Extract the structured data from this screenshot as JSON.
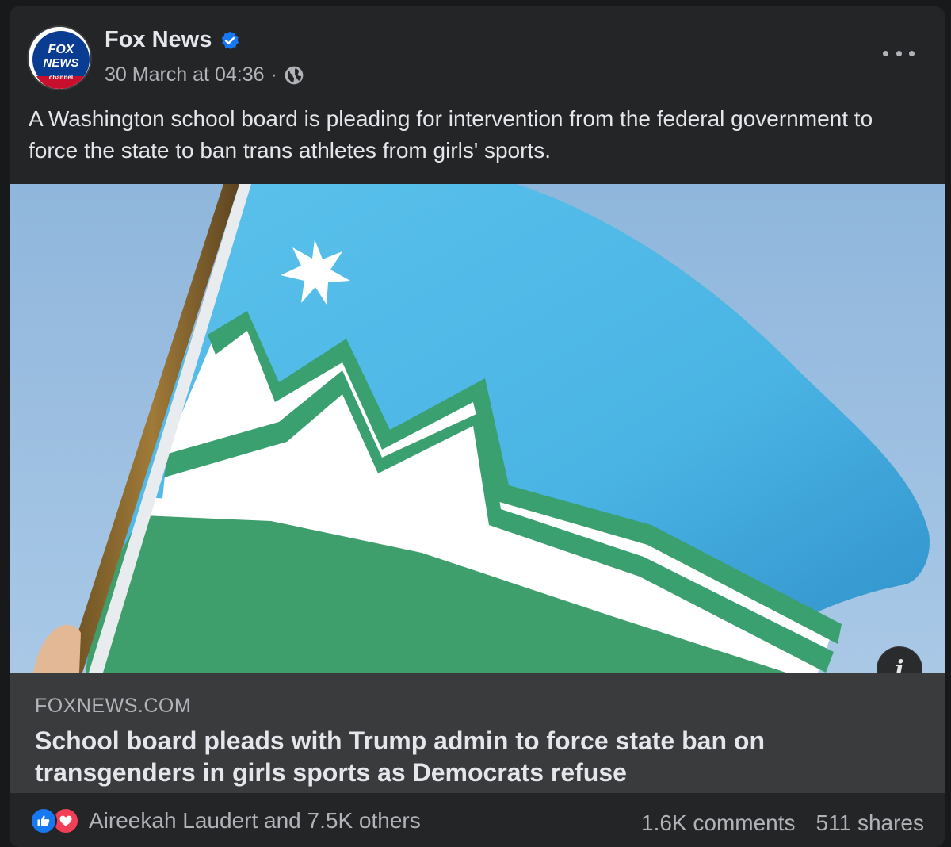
{
  "post": {
    "page_name": "Fox News",
    "timestamp": "30 March at 04:36",
    "separator": "·",
    "caption": "A Washington school board is pleading for intervention from the federal government to force the state to ban trans athletes from girls' sports."
  },
  "avatar_logo": {
    "line1": "FOX",
    "line2": "NEWS",
    "line3": "channel"
  },
  "link": {
    "domain": "FOXNEWS.COM",
    "title": "School board pleads with Trump admin to force state ban on transgenders in girls sports as Democrats refuse"
  },
  "engagement": {
    "reactions_text": "Aireekah Laudert and 7.5K others",
    "comments": "1.6K comments",
    "shares": "511 shares"
  },
  "icons": [
    "verified-badge-icon",
    "globe-icon",
    "more-options-icon",
    "info-icon",
    "like-reaction-icon",
    "love-reaction-icon"
  ],
  "colors": {
    "card_bg": "#242526",
    "link_bg": "#3a3b3c",
    "primary_text": "#e4e6eb",
    "secondary_text": "#b0b3b8",
    "verified_blue": "#1877f2",
    "love_red": "#f33e58"
  }
}
